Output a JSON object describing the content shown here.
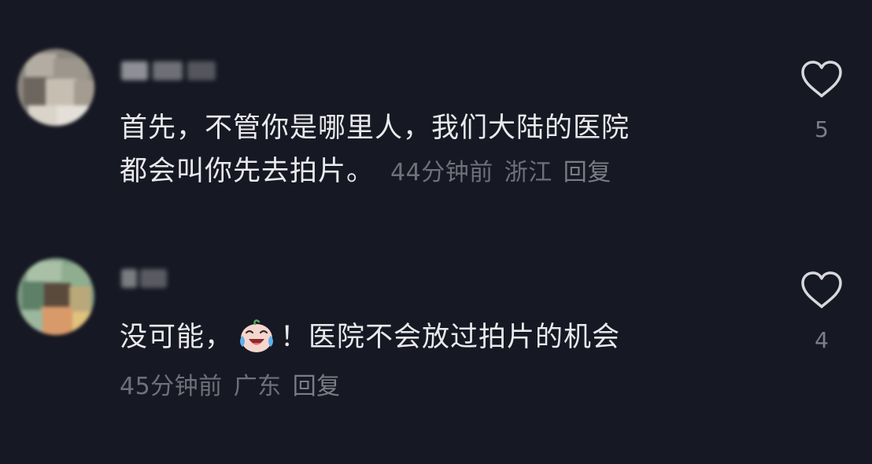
{
  "comments": [
    {
      "text_line1": "首先，不管你是哪里人，我们大陆的医院",
      "text_line2": "都会叫你先去拍片。",
      "time": "44分钟前",
      "location": "浙江",
      "reply_label": "回复",
      "like_count": "5",
      "avatar_icon": "pixelated-avatar",
      "username_icon": "pixelated-username"
    },
    {
      "text_before_emoji": "没可能，",
      "emoji_icon": "crying-laughing-face-emoji",
      "text_after_emoji": "！医院不会放过拍片的机会",
      "time": "45分钟前",
      "location": "广东",
      "reply_label": "回复",
      "like_count": "4",
      "avatar_icon": "pixelated-avatar",
      "username_icon": "pixelated-username"
    }
  ],
  "colors": {
    "background": "#161823",
    "text": "#e9e9ec",
    "meta": "#6e707a",
    "icon": "#d8d8dc"
  }
}
